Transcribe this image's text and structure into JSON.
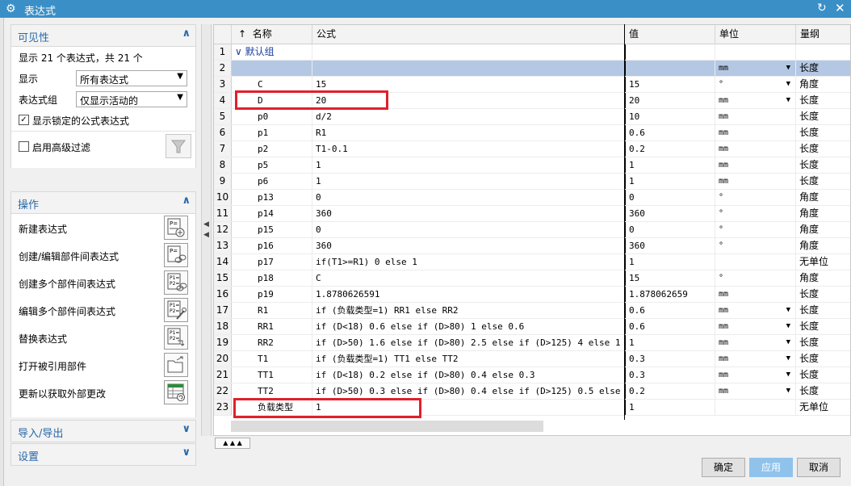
{
  "window": {
    "title": "表达式"
  },
  "left": {
    "visibility": {
      "title": "可见性",
      "summary": "显示 21 个表达式，共 21 个",
      "show_label": "显示",
      "show_value": "所有表达式",
      "group_label": "表达式组",
      "group_value": "仅显示活动的",
      "locked_label": "显示锁定的公式表达式",
      "locked_checked": true,
      "advanced_label": "启用高级过滤",
      "advanced_checked": false
    },
    "operations": {
      "title": "操作",
      "items": [
        "新建表达式",
        "创建/编辑部件间表达式",
        "创建多个部件间表达式",
        "编辑多个部件间表达式",
        "替换表达式",
        "打开被引用部件",
        "更新以获取外部更改"
      ]
    },
    "import_export": {
      "title": "导入/导出"
    },
    "settings": {
      "title": "设置"
    }
  },
  "table": {
    "headers": {
      "sort": "↑",
      "name": "名称",
      "formula": "公式",
      "value": "值",
      "unit": "单位",
      "dimension": "量纲"
    },
    "group_row": {
      "num": "1",
      "name": "默认组"
    },
    "rows": [
      {
        "num": "2",
        "name": "",
        "formula": "",
        "value": "",
        "unit": "mm",
        "dim": "长度",
        "dropdown": true
      },
      {
        "num": "3",
        "name": "C",
        "formula": "15",
        "value": "15",
        "unit": "°",
        "dim": "角度",
        "dropdown": true
      },
      {
        "num": "4",
        "name": "D",
        "formula": "20",
        "value": "20",
        "unit": "mm",
        "dim": "长度",
        "dropdown": true
      },
      {
        "num": "5",
        "name": "p0",
        "formula": "d/2",
        "value": "10",
        "unit": "mm",
        "dim": "长度"
      },
      {
        "num": "6",
        "name": "p1",
        "formula": "R1",
        "value": "0.6",
        "unit": "mm",
        "dim": "长度"
      },
      {
        "num": "7",
        "name": "p2",
        "formula": "T1-0.1",
        "value": "0.2",
        "unit": "mm",
        "dim": "长度"
      },
      {
        "num": "8",
        "name": "p5",
        "formula": "1",
        "value": "1",
        "unit": "mm",
        "dim": "长度"
      },
      {
        "num": "9",
        "name": "p6",
        "formula": "1",
        "value": "1",
        "unit": "mm",
        "dim": "长度"
      },
      {
        "num": "10",
        "name": "p13",
        "formula": "0",
        "value": "0",
        "unit": "°",
        "dim": "角度"
      },
      {
        "num": "11",
        "name": "p14",
        "formula": "360",
        "value": "360",
        "unit": "°",
        "dim": "角度"
      },
      {
        "num": "12",
        "name": "p15",
        "formula": "0",
        "value": "0",
        "unit": "°",
        "dim": "角度"
      },
      {
        "num": "13",
        "name": "p16",
        "formula": "360",
        "value": "360",
        "unit": "°",
        "dim": "角度"
      },
      {
        "num": "14",
        "name": "p17",
        "formula": "if(T1>=R1) 0 else 1",
        "value": "1",
        "unit": "",
        "dim": "无单位"
      },
      {
        "num": "15",
        "name": "p18",
        "formula": "C",
        "value": "15",
        "unit": "°",
        "dim": "角度"
      },
      {
        "num": "16",
        "name": "p19",
        "formula": "1.8780626591",
        "value": "1.878062659",
        "unit": "mm",
        "dim": "长度"
      },
      {
        "num": "17",
        "name": "R1",
        "formula": "if (负载类型=1) RR1 else RR2",
        "value": "0.6",
        "unit": "mm",
        "dim": "长度",
        "dropdown": true
      },
      {
        "num": "18",
        "name": "RR1",
        "formula": "if (D<18) 0.6 else if (D>80) 1 else 0.6",
        "value": "0.6",
        "unit": "mm",
        "dim": "长度",
        "dropdown": true
      },
      {
        "num": "19",
        "name": "RR2",
        "formula": "if (D>50) 1.6 else if (D>80) 2.5 else if (D>125) 4 else 1",
        "value": "1",
        "unit": "mm",
        "dim": "长度",
        "dropdown": true
      },
      {
        "num": "20",
        "name": "T1",
        "formula": "if (负载类型=1) TT1 else TT2",
        "value": "0.3",
        "unit": "mm",
        "dim": "长度",
        "dropdown": true
      },
      {
        "num": "21",
        "name": "TT1",
        "formula": "if (D<18) 0.2 else if (D>80) 0.4 else 0.3",
        "value": "0.3",
        "unit": "mm",
        "dim": "长度",
        "dropdown": true
      },
      {
        "num": "22",
        "name": "TT2",
        "formula": "if (D>50) 0.3 else if (D>80) 0.4 else if (D>125) 0.5 else 0.2",
        "value": "0.2",
        "unit": "mm",
        "dim": "长度",
        "dropdown": true
      },
      {
        "num": "23",
        "name": "负载类型",
        "formula": "1",
        "value": "1",
        "unit": "",
        "dim": "无单位"
      }
    ]
  },
  "footer": {
    "ok": "确定",
    "apply": "应用",
    "cancel": "取消"
  }
}
